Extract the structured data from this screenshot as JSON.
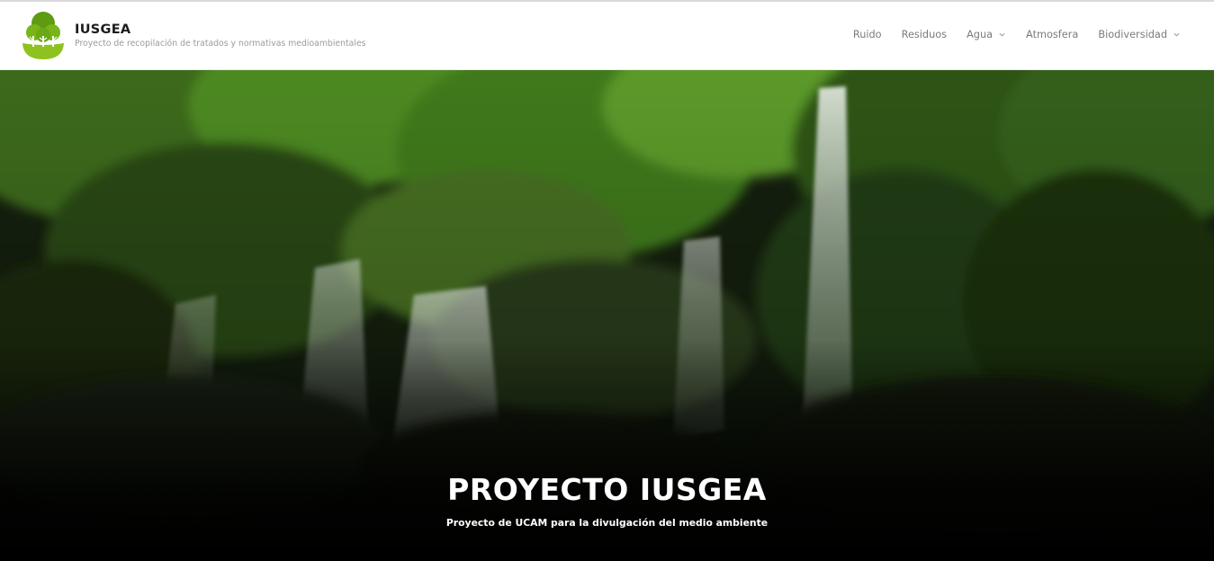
{
  "site": {
    "title": "IUSGEA",
    "tagline": "Proyecto de recopilación de tratados y normativas medioambientales",
    "logo_icon": "tree-logo-icon"
  },
  "nav": {
    "items": [
      {
        "label": "Ruido",
        "has_dropdown": false
      },
      {
        "label": "Residuos",
        "has_dropdown": false
      },
      {
        "label": "Agua",
        "has_dropdown": true
      },
      {
        "label": "Atmosfera",
        "has_dropdown": false
      },
      {
        "label": "Biodiversidad",
        "has_dropdown": true
      }
    ],
    "dropdown_icon": "chevron-down-icon"
  },
  "hero": {
    "title": "PROYECTO IUSGEA",
    "subtitle": "Proyecto de UCAM para la divulgación del medio ambiente",
    "image": "waterfall-forest-photo"
  },
  "colors": {
    "brand_green": "#7cb518",
    "nav_text": "#7b7b7b",
    "title_text": "#1c1c1c",
    "tagline_text": "#9b9b9b",
    "hero_text": "#ffffff"
  }
}
